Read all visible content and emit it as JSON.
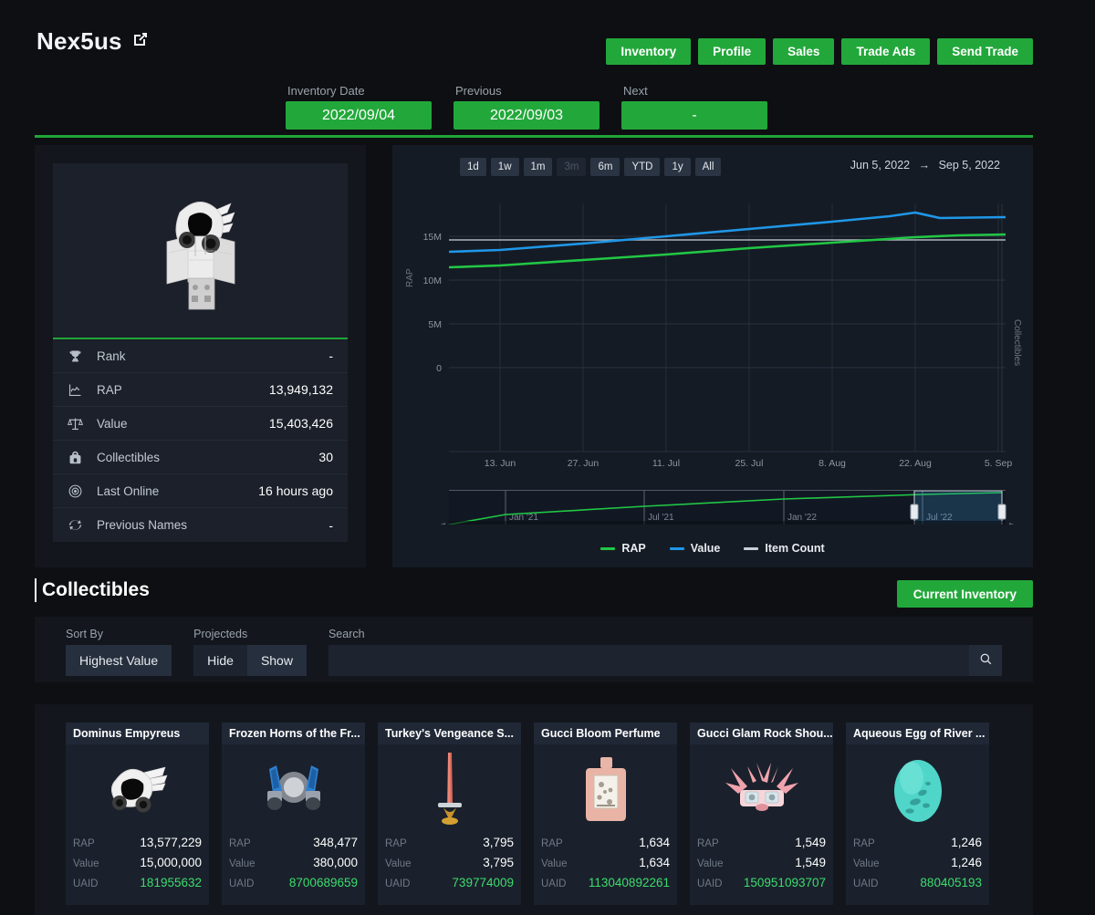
{
  "header": {
    "username": "Nex5us",
    "external_link_icon": "external-link-icon",
    "nav_buttons": [
      {
        "label": "Inventory"
      },
      {
        "label": "Profile"
      },
      {
        "label": "Sales"
      },
      {
        "label": "Trade Ads"
      },
      {
        "label": "Send Trade"
      }
    ]
  },
  "date_nav": [
    {
      "label": "Inventory Date",
      "value": "2022/09/04"
    },
    {
      "label": "Previous",
      "value": "2022/09/03"
    },
    {
      "label": "Next",
      "value": "-"
    }
  ],
  "profile": {
    "avatar_alt": "roblox-avatar",
    "stats": [
      {
        "icon": "trophy-icon",
        "label": "Rank",
        "value": "-"
      },
      {
        "icon": "chart-icon",
        "label": "RAP",
        "value": "13,949,132"
      },
      {
        "icon": "scales-icon",
        "label": "Value",
        "value": "15,403,426"
      },
      {
        "icon": "backpack-icon",
        "label": "Collectibles",
        "value": "30"
      },
      {
        "icon": "target-icon",
        "label": "Last Online",
        "value": "16 hours ago"
      },
      {
        "icon": "refresh-icon",
        "label": "Previous Names",
        "value": "-"
      }
    ]
  },
  "chart_panel": {
    "range_buttons": [
      {
        "label": "1d",
        "disabled": false
      },
      {
        "label": "1w",
        "disabled": false
      },
      {
        "label": "1m",
        "disabled": false
      },
      {
        "label": "3m",
        "disabled": true
      },
      {
        "label": "6m",
        "disabled": false
      },
      {
        "label": "YTD",
        "disabled": false
      },
      {
        "label": "1y",
        "disabled": false
      },
      {
        "label": "All",
        "disabled": false
      }
    ],
    "range_start": "Jun 5, 2022",
    "range_arrow": "→",
    "range_end": "Sep 5, 2022",
    "navigator_ticks": [
      "Jan '21",
      "Jul '21",
      "Jan '22",
      "Jul '22"
    ],
    "legend": [
      {
        "name": "RAP",
        "color": "#21c745"
      },
      {
        "name": "Value",
        "color": "#1f97e8"
      },
      {
        "name": "Item Count",
        "color": "#c8cfd8"
      }
    ]
  },
  "chart_data": {
    "type": "line",
    "title": "",
    "xlabel": "",
    "ylabel": "RAP",
    "y2label": "Collectibles",
    "grid": true,
    "legend_position": "bottom",
    "xlim": [
      "Jun 5, 2022",
      "Sep 5, 2022"
    ],
    "ylim": [
      0,
      16500000
    ],
    "y_ticks": [
      0,
      5000000,
      10000000,
      15000000
    ],
    "y_tick_labels": [
      "0",
      "5M",
      "10M",
      "15M"
    ],
    "x_tick_labels": [
      "13. Jun",
      "27. Jun",
      "11. Jul",
      "25. Jul",
      "8. Aug",
      "22. Aug",
      "5. Sep"
    ],
    "x": [
      "Jun 5",
      "Jun 13",
      "Jun 27",
      "Jul 11",
      "Jul 25",
      "Aug 8",
      "Aug 22",
      "Aug 26",
      "Sep 5"
    ],
    "series": [
      {
        "name": "RAP",
        "color": "#21c745",
        "values": [
          12400000,
          12480000,
          12700000,
          12950000,
          13250000,
          13530000,
          13800000,
          13860000,
          13949132
        ]
      },
      {
        "name": "Value",
        "color": "#1f97e8",
        "values": [
          13750000,
          13830000,
          14080000,
          14380000,
          14700000,
          15020000,
          15320000,
          15460000,
          15403426
        ]
      },
      {
        "name": "Item Count",
        "color": "#c8cfd8",
        "values": [
          30,
          30,
          30,
          30,
          30,
          30,
          30,
          30,
          30
        ]
      }
    ],
    "navigator": {
      "x_tick_labels": [
        "Jan '21",
        "Jul '21",
        "Jan '22",
        "Jul '22"
      ],
      "series_name": "RAP",
      "selection_start": "Jun 5, 2022",
      "selection_end": "Sep 5, 2022"
    }
  },
  "collectibles": {
    "title": "Collectibles",
    "current_inventory_label": "Current Inventory",
    "filters": {
      "sort_by_label": "Sort By",
      "sort_by_value": "Highest Value",
      "projecteds_label": "Projecteds",
      "projecteds_options": [
        {
          "label": "Hide",
          "active": false
        },
        {
          "label": "Show",
          "active": true
        }
      ],
      "search_label": "Search",
      "search_value": "",
      "search_placeholder": "",
      "search_icon": "search-icon"
    },
    "field_labels": {
      "rap": "RAP",
      "value": "Value",
      "uaid": "UAID"
    },
    "items": [
      {
        "name": "Dominus Empyreus",
        "thumb": "dominus-empyreus",
        "rap": "13,577,229",
        "value": "15,000,000",
        "uaid": "181955632"
      },
      {
        "name": "Frozen Horns of the Fr...",
        "thumb": "frozen-horns",
        "rap": "348,477",
        "value": "380,000",
        "uaid": "8700689659"
      },
      {
        "name": "Turkey's Vengeance S...",
        "thumb": "turkey-sword",
        "rap": "3,795",
        "value": "3,795",
        "uaid": "739774009"
      },
      {
        "name": "Gucci Bloom Perfume",
        "thumb": "gucci-perfume",
        "rap": "1,634",
        "value": "1,634",
        "uaid": "113040892261"
      },
      {
        "name": "Gucci Glam Rock Shou...",
        "thumb": "gucci-glam-rock",
        "rap": "1,549",
        "value": "1,549",
        "uaid": "150951093707"
      },
      {
        "name": "Aqueous Egg of River ...",
        "thumb": "aqueous-egg",
        "rap": "1,246",
        "value": "1,246",
        "uaid": "880405193"
      }
    ]
  },
  "colors": {
    "accent_green": "#22a83a",
    "line_rap": "#21c745",
    "line_value": "#1f97e8",
    "line_item_count": "#c8cfd8",
    "uaid_green": "#3ddc6e",
    "background": "#0d0f12",
    "panel": "#13161c"
  }
}
